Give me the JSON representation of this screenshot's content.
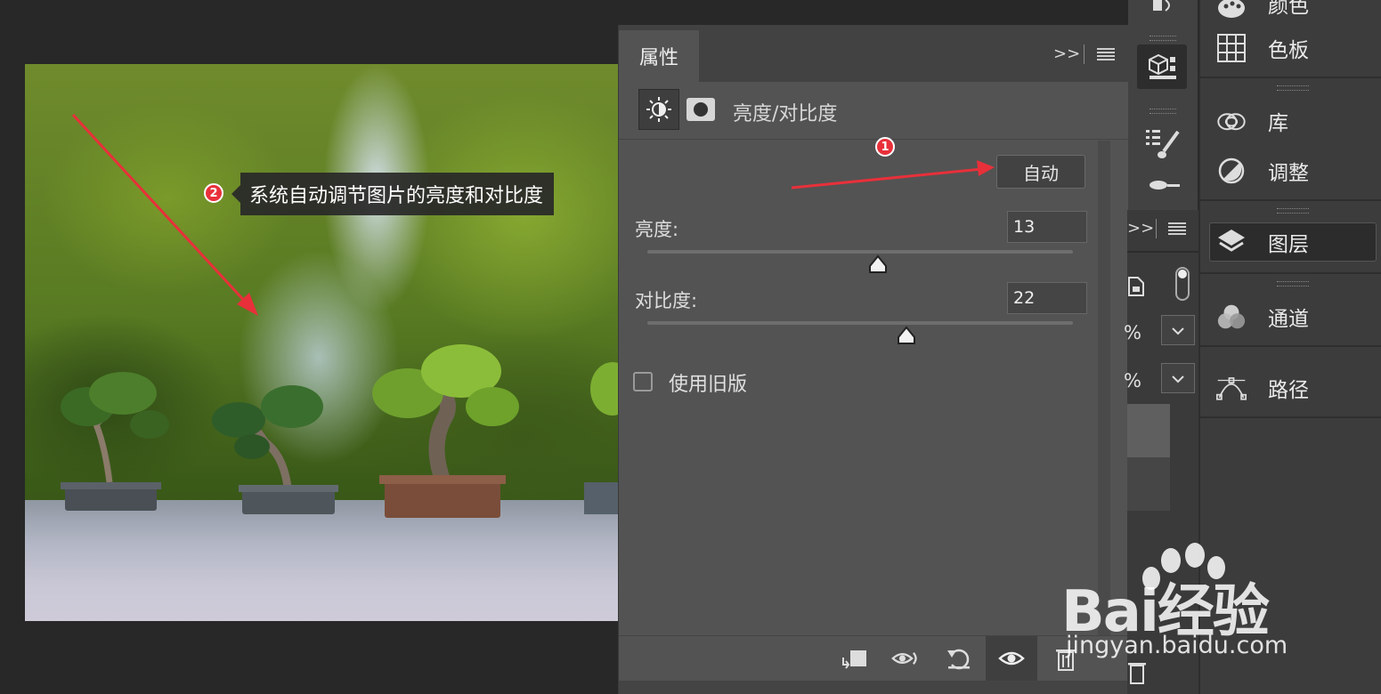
{
  "photo_callout": {
    "badge": "2",
    "text": "系统自动调节图片的亮度和对比度"
  },
  "properties_panel": {
    "tab_label": "属性",
    "expand_glyph": ">>",
    "title": "亮度/对比度",
    "auto_button": "自动",
    "auto_badge": "1",
    "brightness": {
      "label": "亮度:",
      "value": "13",
      "slider_position": 0.542
    },
    "contrast": {
      "label": "对比度:",
      "value": "22",
      "slider_position": 0.608
    },
    "legacy_label": "使用旧版",
    "legacy_checked": false,
    "bottom_icons": [
      "clip-to-layer-icon",
      "view-previous-state-icon",
      "reset-icon",
      "visibility-eye-icon",
      "delete-icon"
    ]
  },
  "middle_toolbar": {
    "expand_glyph": ">>",
    "opacity_partial": "%",
    "fill_partial": "%"
  },
  "right_panel": {
    "items": [
      {
        "label": "颜色",
        "icon": "palette-icon"
      },
      {
        "label": "色板",
        "icon": "swatches-grid-icon"
      },
      {
        "label": "库",
        "icon": "cloud-library-icon"
      },
      {
        "label": "调整",
        "icon": "half-circle-adjust-icon"
      },
      {
        "label": "图层",
        "icon": "layers-icon",
        "active": true
      },
      {
        "label": "通道",
        "icon": "channels-icon"
      },
      {
        "label": "路径",
        "icon": "pen-path-icon"
      }
    ]
  },
  "watermark": {
    "brand": "Bai经验",
    "url": "jingyan.baidu.com"
  },
  "colors": {
    "accent_red": "#e8303a",
    "panel": "#535353",
    "app_bg": "#282828"
  }
}
